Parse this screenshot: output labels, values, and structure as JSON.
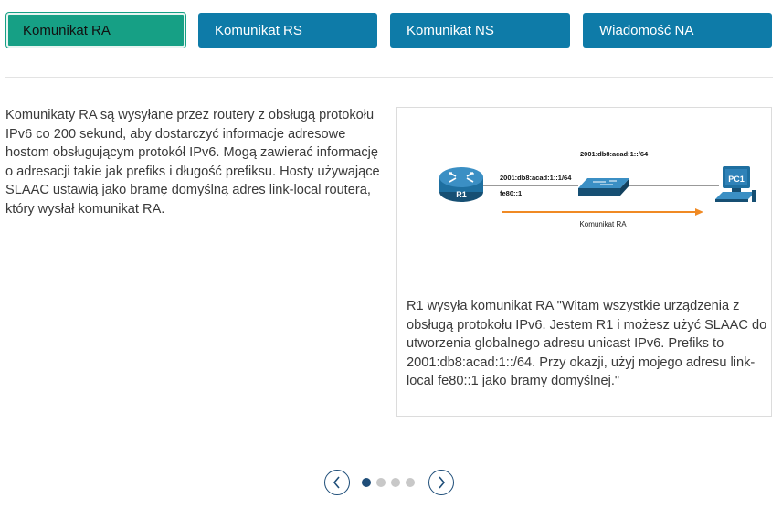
{
  "tabs": [
    {
      "label": "Komunikat RA",
      "active": true
    },
    {
      "label": "Komunikat RS",
      "active": false
    },
    {
      "label": "Komunikat NS",
      "active": false
    },
    {
      "label": "Wiadomość NA",
      "active": false
    }
  ],
  "description": "Komunikaty RA są wysyłane przez routery z obsługą protokołu IPv6 co 200 sekund, aby dostarczyć informacje adresowe hostom obsługującym protokół IPv6. Mogą zawierać informację o adresacji takie jak prefiks i długość prefiksu. Hosty używające SLAAC ustawią jako bramę domyślną adres link-local routera, który wysłał komunikat RA.",
  "diagram": {
    "network_label": "2001:db8:acad:1::/64",
    "router_address": "2001:db8:acad:1::1/64",
    "router_link_local": "fe80::1",
    "router_name": "R1",
    "pc_name": "PC1",
    "arrow_label": "Komunikat RA",
    "colors": {
      "device": "#1e6fa0",
      "arrow": "#f08a24",
      "line": "#333333"
    }
  },
  "caption": "R1 wysyła komunikat RA \"Witam wszystkie urządzenia z obsługą protokołu IPv6. Jestem R1 i możesz użyć SLAAC do utworzenia globalnego adresu unicast IPv6. Prefiks to 2001:db8:acad:1::/64. Przy okazji, użyj mojego adresu link-local fe80::1 jako bramy domyślnej.\"",
  "pager": {
    "prev_icon": "chevron-left-icon",
    "next_icon": "chevron-right-icon",
    "total": 4,
    "current": 1
  }
}
